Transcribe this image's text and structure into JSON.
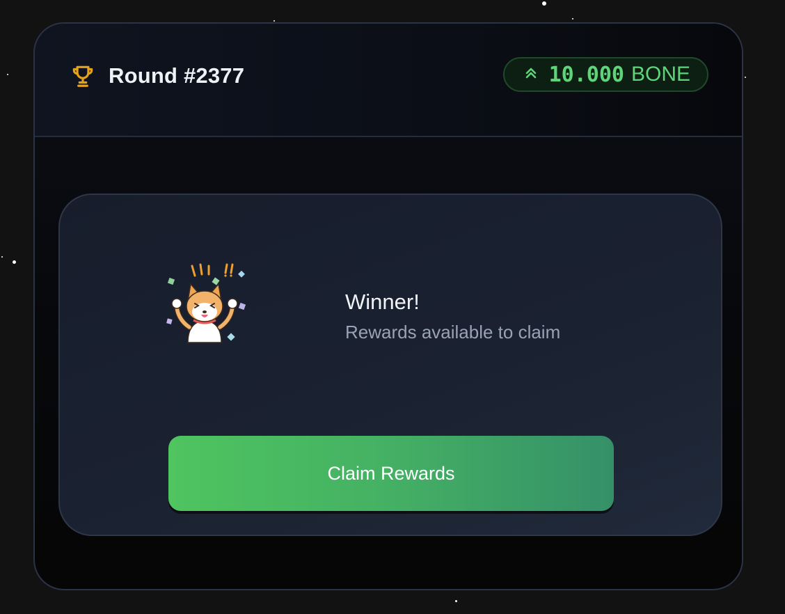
{
  "header": {
    "round_label": "Round #2377",
    "trophy_icon": "trophy-icon",
    "badge": {
      "icon": "chevrons-up-icon",
      "amount": "10.000",
      "unit": "BONE",
      "color": "#5fd47a"
    }
  },
  "result": {
    "sticker_icon": "shiba-celebration-sticker",
    "title": "Winner!",
    "subtitle": "Rewards available to claim"
  },
  "actions": {
    "claim_label": "Claim Rewards"
  },
  "colors": {
    "accent_gold": "#e3a21a",
    "accent_green": "#4fc45f"
  }
}
